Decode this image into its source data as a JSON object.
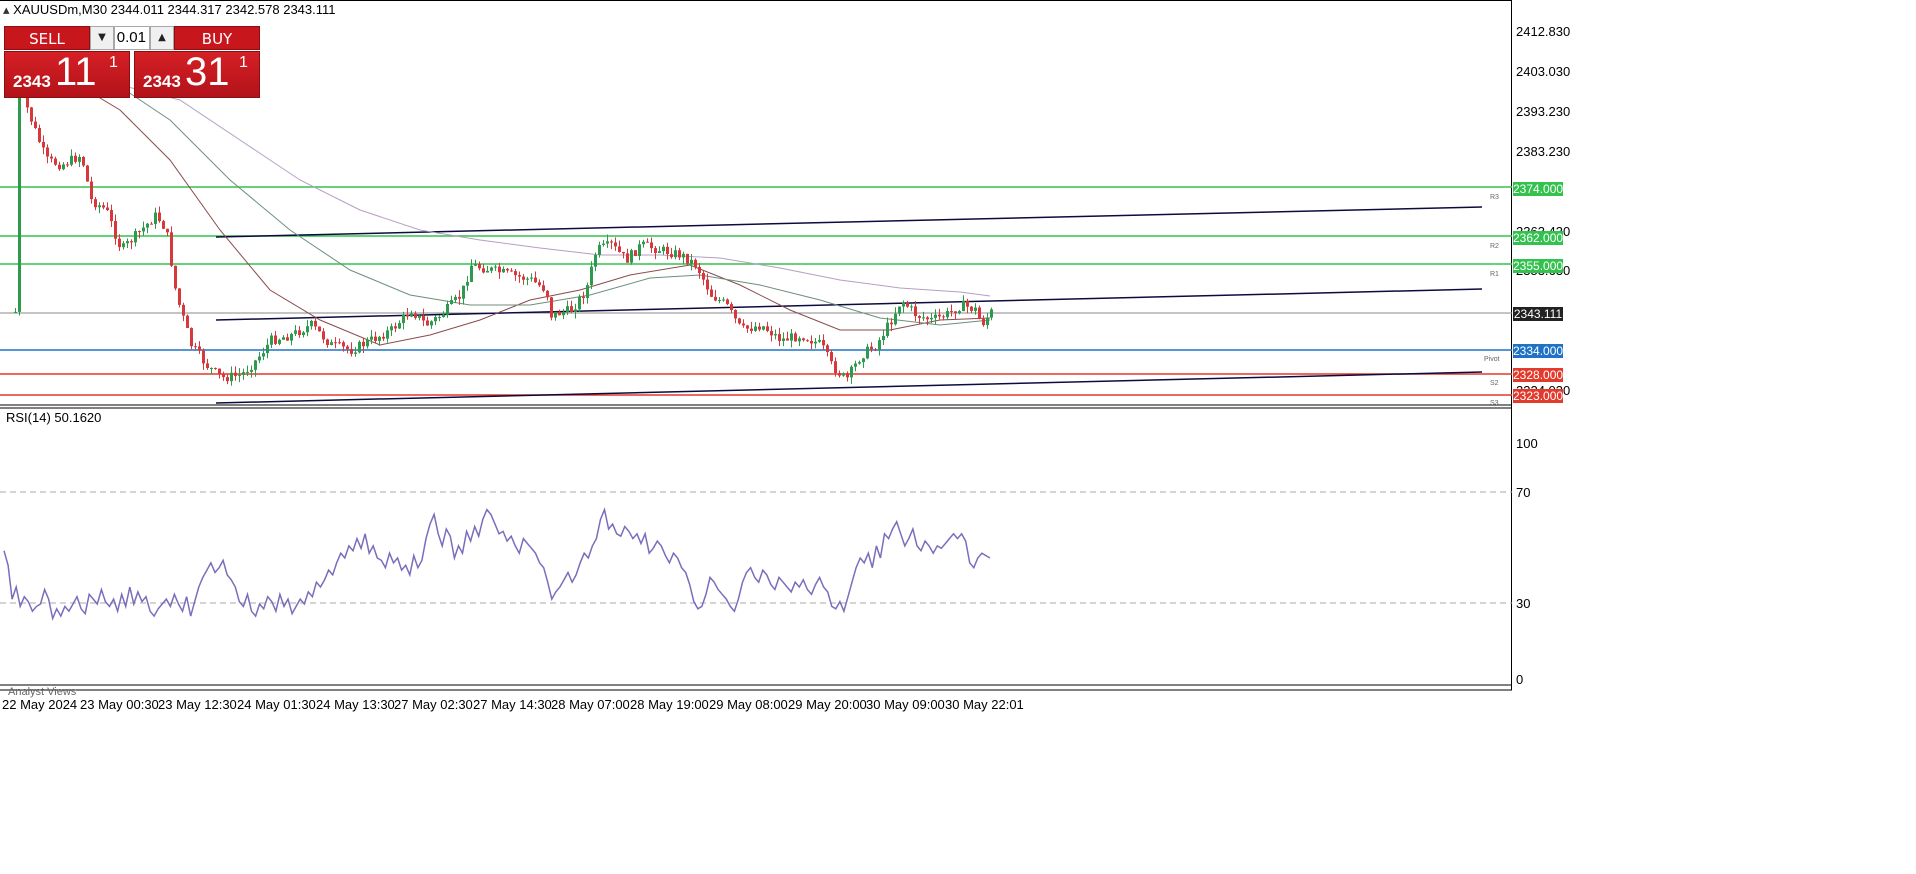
{
  "chart_header": "XAUUSDm,M30  2344.011 2344.317 2342.578 2343.111",
  "trade_panel": {
    "sell_label": "SELL",
    "buy_label": "BUY",
    "volume": "0.01",
    "sell_small": "2343",
    "sell_big": "11",
    "sell_sup": "1",
    "buy_small": "2343",
    "buy_big": "31",
    "buy_sup": "1"
  },
  "price_axis": [
    "2412.830",
    "2403.030",
    "2393.230",
    "2383.230",
    "2363.430",
    "2353.630",
    "2324.030"
  ],
  "level_tags": [
    {
      "label": "2374.000",
      "color": "#33c24d"
    },
    {
      "label": "2362.000",
      "color": "#33c24d"
    },
    {
      "label": "2355.000",
      "color": "#33c24d"
    },
    {
      "label": "2343.111",
      "color": "#222222"
    },
    {
      "label": "2334.000",
      "color": "#1f73c7"
    },
    {
      "label": "2328.000",
      "color": "#e23a2c"
    },
    {
      "label": "2323.000",
      "color": "#e23a2c"
    }
  ],
  "pivot_labels": [
    "R3",
    "R2",
    "R1",
    "Pivot",
    "S2",
    "S3"
  ],
  "rsi": {
    "header": "RSI(14) 50.1620",
    "axis": [
      "100",
      "70",
      "30",
      "0"
    ],
    "current": 50.162,
    "values": [
      53,
      47,
      33,
      38,
      30,
      34,
      32,
      28,
      30,
      31,
      37,
      33,
      25,
      29,
      26,
      30,
      28,
      31,
      34,
      29,
      27,
      35,
      33,
      31,
      37,
      32,
      30,
      33,
      28,
      35,
      30,
      38,
      31,
      36,
      32,
      34,
      28,
      26,
      29,
      31,
      33,
      30,
      35,
      31,
      28,
      34,
      26,
      32,
      38,
      42,
      45,
      48,
      44,
      46,
      49,
      43,
      41,
      38,
      32,
      30,
      35,
      28,
      26,
      31,
      29,
      34,
      32,
      28,
      35,
      30,
      33,
      27,
      30,
      33,
      31,
      36,
      34,
      40,
      38,
      41,
      45,
      43,
      48,
      52,
      50,
      55,
      53,
      58,
      54,
      60,
      52,
      55,
      50,
      49,
      46,
      52,
      48,
      50,
      45,
      47,
      43,
      51,
      46,
      49,
      58,
      64,
      68,
      60,
      55,
      62,
      59,
      50,
      55,
      52,
      61,
      57,
      63,
      59,
      66,
      70,
      68,
      64,
      60,
      61,
      57,
      59,
      55,
      52,
      58,
      56,
      54,
      52,
      48,
      46,
      40,
      33,
      36,
      38,
      41,
      44,
      40,
      43,
      48,
      52,
      50,
      55,
      58,
      66,
      70,
      62,
      64,
      60,
      59,
      63,
      61,
      58,
      60,
      56,
      60,
      52,
      54,
      57,
      55,
      51,
      48,
      52,
      50,
      46,
      44,
      39,
      32,
      29,
      30,
      35,
      42,
      40,
      37,
      35,
      33,
      30,
      28,
      33,
      40,
      44,
      46,
      42,
      40,
      45,
      43,
      39,
      37,
      42,
      40,
      38,
      36,
      40,
      38,
      41,
      37,
      35,
      39,
      42,
      38,
      36,
      30,
      29,
      32,
      28,
      34,
      40,
      46,
      50,
      48,
      52,
      46,
      55,
      50,
      60,
      58,
      62,
      65,
      60,
      55,
      58,
      62,
      55,
      53,
      57,
      55,
      52,
      55,
      54,
      56,
      58,
      60,
      58,
      60,
      57,
      48,
      46,
      50,
      52,
      51,
      50
    ]
  },
  "date_axis": [
    "22 May 2024",
    "23 May 00:30",
    "23 May 12:30",
    "24 May 01:30",
    "24 May 13:30",
    "27 May 02:30",
    "27 May 14:30",
    "28 May 07:00",
    "28 May 19:00",
    "29 May 08:00",
    "29 May 20:00",
    "30 May 09:00",
    "30 May 22:01"
  ],
  "analyst_views": "Analyst Views",
  "colors": {
    "candle_up": "#2e9a4e",
    "candle_down": "#d7383c",
    "ma_fast": "#8b4a4a",
    "ma_mid": "#6c8f7c",
    "ma_slow": "#b59fc3",
    "channel": "#0b0b3f",
    "rsi_line": "#7b6dbb",
    "support_blue": "#1f73c7",
    "support_red": "#e23a2c",
    "resistance_green": "#33c24d"
  }
}
